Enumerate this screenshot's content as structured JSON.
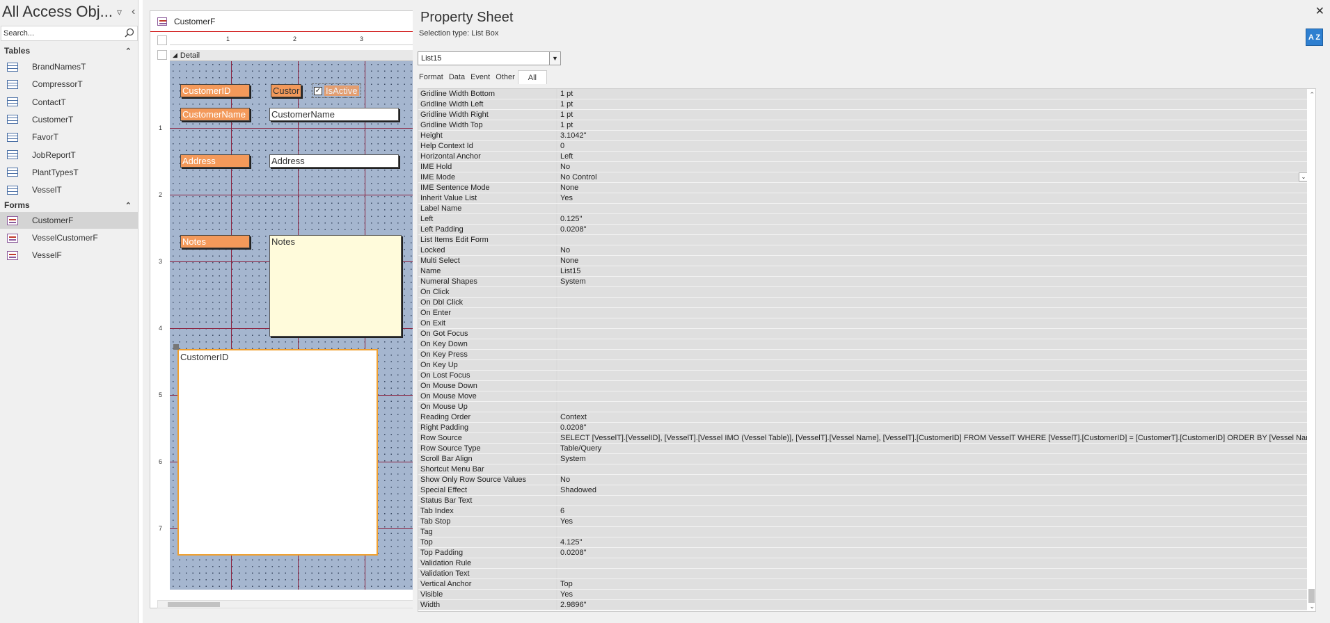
{
  "nav": {
    "title": "All Access Obj...",
    "search_placeholder": "Search...",
    "sections": {
      "tables": {
        "label": "Tables",
        "items": [
          "BrandNamesT",
          "CompressorT",
          "ContactT",
          "CustomerT",
          "FavorT",
          "JobReportT",
          "PlantTypesT",
          "VesselT"
        ]
      },
      "forms": {
        "label": "Forms",
        "items": [
          "CustomerF",
          "VesselCustomerF",
          "VesselF"
        ],
        "selected": "CustomerF"
      }
    }
  },
  "design": {
    "tab_title": "CustomerF",
    "ruler_h": [
      "1",
      "2",
      "3"
    ],
    "ruler_v": [
      "1",
      "2",
      "3",
      "4",
      "5",
      "6",
      "7"
    ],
    "section_label": "Detail",
    "controls": {
      "customerid_label": "CustomerID",
      "customerid_box": "Custor",
      "isactive_label": "IsActive",
      "customername_label": "CustomerName",
      "customername_box": "CustomerName",
      "address_label": "Address",
      "address_box": "Address",
      "notes_label": "Notes",
      "notes_box": "Notes",
      "listbox_text": "CustomerID"
    },
    "colors": {
      "canvas": "#a5b6cf",
      "label": "#f3995a",
      "notes_bg": "#fffbdb",
      "selection": "#f0a030"
    }
  },
  "property_sheet": {
    "title": "Property Sheet",
    "selection_type": "Selection type:  List Box",
    "selected_object": "List15",
    "sort_icon": "A Z",
    "tabs": [
      "Format",
      "Data",
      "Event",
      "Other",
      "All"
    ],
    "active_tab": "All",
    "properties": [
      {
        "name": "Gridline Width Bottom",
        "value": "1 pt"
      },
      {
        "name": "Gridline Width Left",
        "value": "1 pt"
      },
      {
        "name": "Gridline Width Right",
        "value": "1 pt"
      },
      {
        "name": "Gridline Width Top",
        "value": "1 pt"
      },
      {
        "name": "Height",
        "value": "3.1042\""
      },
      {
        "name": "Help Context Id",
        "value": "0"
      },
      {
        "name": "Horizontal Anchor",
        "value": "Left"
      },
      {
        "name": "IME Hold",
        "value": "No"
      },
      {
        "name": "IME Mode",
        "value": "No Control",
        "dropdown": true
      },
      {
        "name": "IME Sentence Mode",
        "value": "None"
      },
      {
        "name": "Inherit Value List",
        "value": "Yes"
      },
      {
        "name": "Label Name",
        "value": ""
      },
      {
        "name": "Left",
        "value": "0.125\""
      },
      {
        "name": "Left Padding",
        "value": "0.0208\""
      },
      {
        "name": "List Items Edit Form",
        "value": ""
      },
      {
        "name": "Locked",
        "value": "No"
      },
      {
        "name": "Multi Select",
        "value": "None"
      },
      {
        "name": "Name",
        "value": "List15"
      },
      {
        "name": "Numeral Shapes",
        "value": "System"
      },
      {
        "name": "On Click",
        "value": ""
      },
      {
        "name": "On Dbl Click",
        "value": ""
      },
      {
        "name": "On Enter",
        "value": ""
      },
      {
        "name": "On Exit",
        "value": ""
      },
      {
        "name": "On Got Focus",
        "value": ""
      },
      {
        "name": "On Key Down",
        "value": ""
      },
      {
        "name": "On Key Press",
        "value": ""
      },
      {
        "name": "On Key Up",
        "value": ""
      },
      {
        "name": "On Lost Focus",
        "value": ""
      },
      {
        "name": "On Mouse Down",
        "value": ""
      },
      {
        "name": "On Mouse Move",
        "value": ""
      },
      {
        "name": "On Mouse Up",
        "value": ""
      },
      {
        "name": "Reading Order",
        "value": "Context"
      },
      {
        "name": "Right Padding",
        "value": "0.0208\""
      },
      {
        "name": "Row Source",
        "value": "SELECT [VesselT].[VesselID], [VesselT].[Vessel IMO (Vessel Table)], [VesselT].[Vessel Name], [VesselT].[CustomerID] FROM VesselT WHERE [VesselT].[CustomerID] = [CustomerT].[CustomerID] ORDER BY [Vessel Name];"
      },
      {
        "name": "Row Source Type",
        "value": "Table/Query"
      },
      {
        "name": "Scroll Bar Align",
        "value": "System"
      },
      {
        "name": "Shortcut Menu Bar",
        "value": ""
      },
      {
        "name": "Show Only Row Source Values",
        "value": "No"
      },
      {
        "name": "Special Effect",
        "value": "Shadowed"
      },
      {
        "name": "Status Bar Text",
        "value": ""
      },
      {
        "name": "Tab Index",
        "value": "6"
      },
      {
        "name": "Tab Stop",
        "value": "Yes"
      },
      {
        "name": "Tag",
        "value": ""
      },
      {
        "name": "Top",
        "value": "4.125\""
      },
      {
        "name": "Top Padding",
        "value": "0.0208\""
      },
      {
        "name": "Validation Rule",
        "value": ""
      },
      {
        "name": "Validation Text",
        "value": ""
      },
      {
        "name": "Vertical Anchor",
        "value": "Top"
      },
      {
        "name": "Visible",
        "value": "Yes"
      },
      {
        "name": "Width",
        "value": "2.9896\""
      }
    ]
  }
}
